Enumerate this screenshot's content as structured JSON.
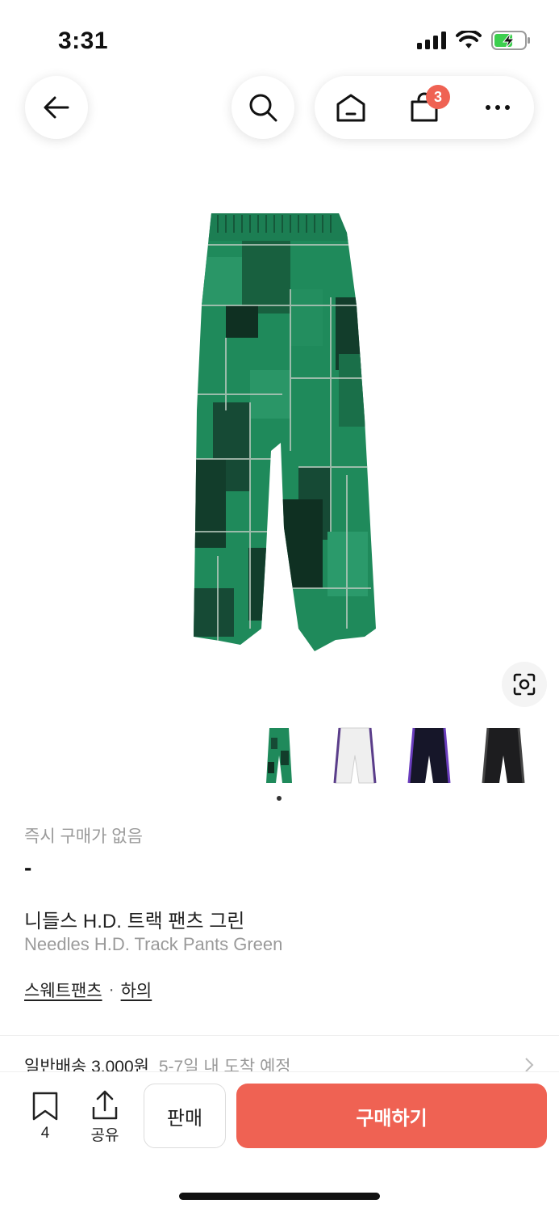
{
  "status_bar": {
    "time": "3:31"
  },
  "header": {
    "cart_badge": "3"
  },
  "product": {
    "availability_label": "즉시 구매가 없음",
    "price": "-",
    "name_ko": "니들스 H.D. 트랙 팬츠 그린",
    "name_en": "Needles H.D. Track Pants Green",
    "category_1": "스웨트팬츠",
    "category_sep": "·",
    "category_2": "하의"
  },
  "shipping": {
    "label": "일반배송 3,000원",
    "eta": "5-7일 내 도착 예정"
  },
  "bottom": {
    "bookmark_count": "4",
    "share_label": "공유",
    "sell_label": "판매",
    "buy_label": "구매하기"
  },
  "colors": {
    "accent": "#ef6253",
    "pants_green": "#1f8a5b",
    "pants_dark_green": "#164a35"
  }
}
